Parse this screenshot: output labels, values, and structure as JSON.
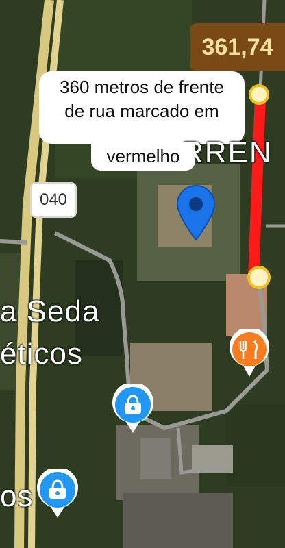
{
  "measurement": {
    "distance": "361,74"
  },
  "annotation": {
    "line1": "360 metros de frente",
    "line2": "de rua marcado em",
    "line3": "vermelho"
  },
  "labels": {
    "road_shield": "040",
    "place_line1": "a Seda",
    "place_line2": "éticos",
    "place_bottom": "os",
    "street_partial": "RREN"
  },
  "icons": [
    "location-pin-icon",
    "restaurant-icon",
    "shopping-bag-icon",
    "shopping-bag-icon"
  ],
  "colors": {
    "measure_line": "#ff1a1a",
    "pin": "#1a73e8",
    "restaurant": "#f57c1f",
    "shopping": "#2196f3"
  }
}
